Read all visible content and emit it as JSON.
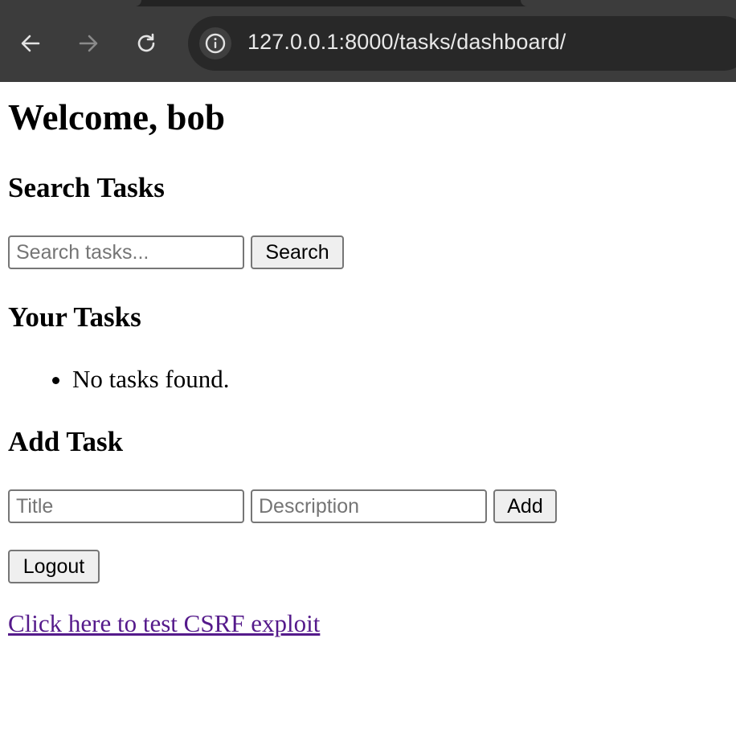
{
  "browser": {
    "url": "127.0.0.1:8000/tasks/dashboard/",
    "icons": {
      "back": "back-arrow-icon",
      "forward": "forward-arrow-icon",
      "reload": "reload-icon",
      "site_info": "info-icon"
    }
  },
  "page": {
    "welcome": "Welcome, bob",
    "search": {
      "heading": "Search Tasks",
      "placeholder": "Search tasks...",
      "value": "",
      "button_label": "Search"
    },
    "tasks": {
      "heading": "Your Tasks",
      "items": [
        "No tasks found."
      ]
    },
    "add_task": {
      "heading": "Add Task",
      "title_placeholder": "Title",
      "description_placeholder": "Description",
      "button_label": "Add"
    },
    "logout_label": "Logout",
    "csrf_link": "Click here to test CSRF exploit"
  },
  "colors": {
    "chrome_bg": "#3c3c3c",
    "omnibox_bg": "#282828",
    "visited_link": "#551a8b"
  }
}
